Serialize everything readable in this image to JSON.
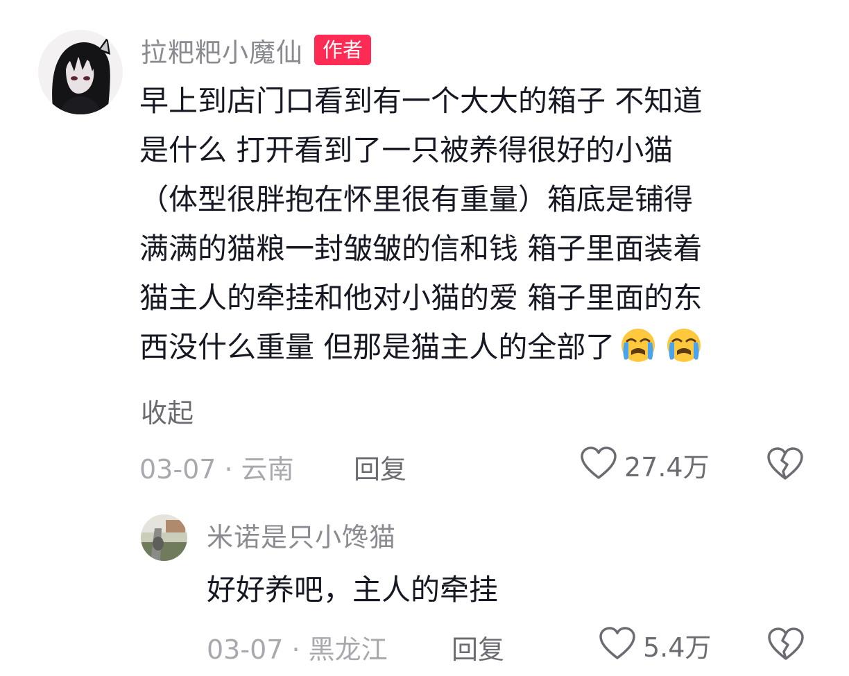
{
  "main_comment": {
    "username": "拉粑粑小魔仙",
    "author_badge": "作者",
    "text": "早上到店门口看到有一个大大的箱子 不知道\n是什么 打开看到了一只被养得很好的小猫\n（体型很胖抱在怀里很有重量）箱底是铺得\n满满的猫粮一封皱皱的信和钱 箱子里面装着\n猫主人的牵挂和他对小猫的爱 箱子里面的东\n西没什么重量 但那是猫主人的全部了",
    "emojis": [
      "crying-face-icon",
      "crying-face-icon"
    ],
    "collapse_label": "收起",
    "date_location": "03-07 · 云南",
    "reply_label": "回复",
    "like_count": "27.4万"
  },
  "reply_comment": {
    "username": "米诺是只小馋猫",
    "text": "好好养吧，主人的牵挂",
    "date_location": "03-07 · 黑龙江",
    "reply_label": "回复",
    "like_count": "5.4万"
  },
  "colors": {
    "badge": "#fe2c55",
    "username": "#8a8b91",
    "meta": "#a8a9ae",
    "text": "#161823"
  }
}
